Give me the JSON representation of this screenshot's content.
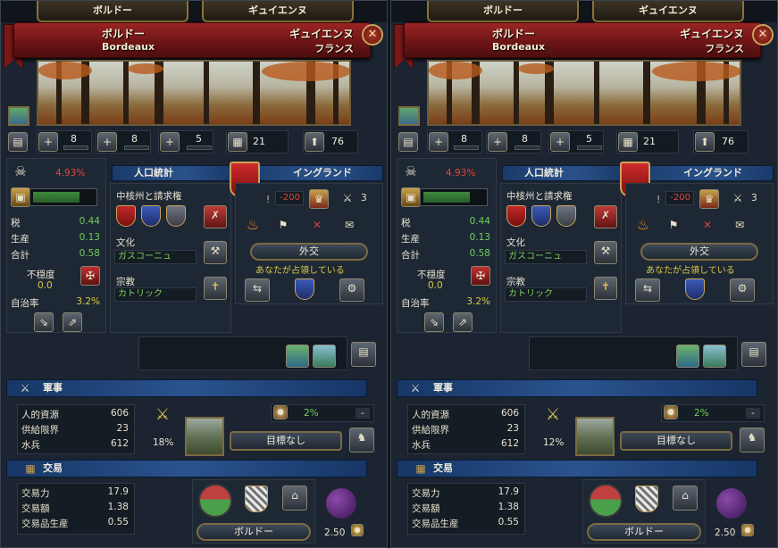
{
  "panels": [
    {
      "tab_left": "ボルドー",
      "tab_right": "ギュイエンヌ",
      "province_jp": "ボルドー",
      "province_en": "Bordeaux",
      "area": "ギュイエンヌ",
      "country": "フランス",
      "stats": {
        "a": "8",
        "b": "8",
        "c": "5",
        "d": "21",
        "e": "76"
      },
      "devastation": "4.93%",
      "tax": {
        "label": "税",
        "value": "0.44"
      },
      "production": {
        "label": "生産",
        "value": "0.13"
      },
      "total": {
        "label": "合計",
        "value": "0.58"
      },
      "unrest": {
        "label": "不穏度",
        "value": "0.0"
      },
      "autonomy": {
        "label": "自治率",
        "value": "3.2%"
      },
      "population_header": "人口統計",
      "cores_label": "中核州と請求権",
      "culture_label": "文化",
      "culture_value": "ガスコーニュ",
      "religion_label": "宗教",
      "religion_value": "カトリック",
      "owner_header": "イングランド",
      "opinion": "-200",
      "count": "3",
      "diplomacy_btn": "外交",
      "occupied_text": "あなたが占領している",
      "military_header": "軍事",
      "manpower": {
        "label": "人的資源",
        "value": "606"
      },
      "supply": {
        "label": "供給限界",
        "value": "23"
      },
      "sailors": {
        "label": "水兵",
        "value": "612"
      },
      "fort_pct": "18%",
      "siege_pct": "2%",
      "siege_dash": "-",
      "target_btn": "目標なし",
      "trade_header": "交易",
      "trade_power": {
        "label": "交易力",
        "value": "17.9"
      },
      "trade_value": {
        "label": "交易額",
        "value": "1.38"
      },
      "goods_produced": {
        "label": "交易品生産",
        "value": "0.55"
      },
      "node_btn": "ボルドー",
      "goods_price": "2.50"
    },
    {
      "tab_left": "ボルドー",
      "tab_right": "ギュイエンヌ",
      "province_jp": "ボルドー",
      "province_en": "Bordeaux",
      "area": "ギュイエンヌ",
      "country": "フランス",
      "stats": {
        "a": "8",
        "b": "8",
        "c": "5",
        "d": "21",
        "e": "76"
      },
      "devastation": "4.93%",
      "tax": {
        "label": "税",
        "value": "0.44"
      },
      "production": {
        "label": "生産",
        "value": "0.13"
      },
      "total": {
        "label": "合計",
        "value": "0.58"
      },
      "unrest": {
        "label": "不穏度",
        "value": "0.0"
      },
      "autonomy": {
        "label": "自治率",
        "value": "3.2%"
      },
      "population_header": "人口統計",
      "cores_label": "中核州と請求権",
      "culture_label": "文化",
      "culture_value": "ガスコーニュ",
      "religion_label": "宗教",
      "religion_value": "カトリック",
      "owner_header": "イングランド",
      "opinion": "-200",
      "count": "3",
      "diplomacy_btn": "外交",
      "occupied_text": "あなたが占領している",
      "military_header": "軍事",
      "manpower": {
        "label": "人的資源",
        "value": "606"
      },
      "supply": {
        "label": "供給限界",
        "value": "23"
      },
      "sailors": {
        "label": "水兵",
        "value": "612"
      },
      "fort_pct": "12%",
      "siege_pct": "2%",
      "siege_dash": "-",
      "target_btn": "目標なし",
      "trade_header": "交易",
      "trade_power": {
        "label": "交易力",
        "value": "17.9"
      },
      "trade_value": {
        "label": "交易額",
        "value": "1.38"
      },
      "goods_produced": {
        "label": "交易品生産",
        "value": "0.55"
      },
      "node_btn": "ボルドー",
      "goods_price": "2.50"
    }
  ],
  "colors": {
    "ribbon": "#8a1e1e",
    "header_blue": "#2a528a",
    "positive": "#6ecf5a",
    "negative": "#e0453a"
  },
  "icons": [
    "close-icon",
    "skull-icon",
    "treasure-icon",
    "shield-icon",
    "fire-icon",
    "flag-icon",
    "crossed-swords-icon",
    "dove-icon",
    "cross-icon",
    "gear-icon",
    "book-icon",
    "grapes-icon"
  ]
}
